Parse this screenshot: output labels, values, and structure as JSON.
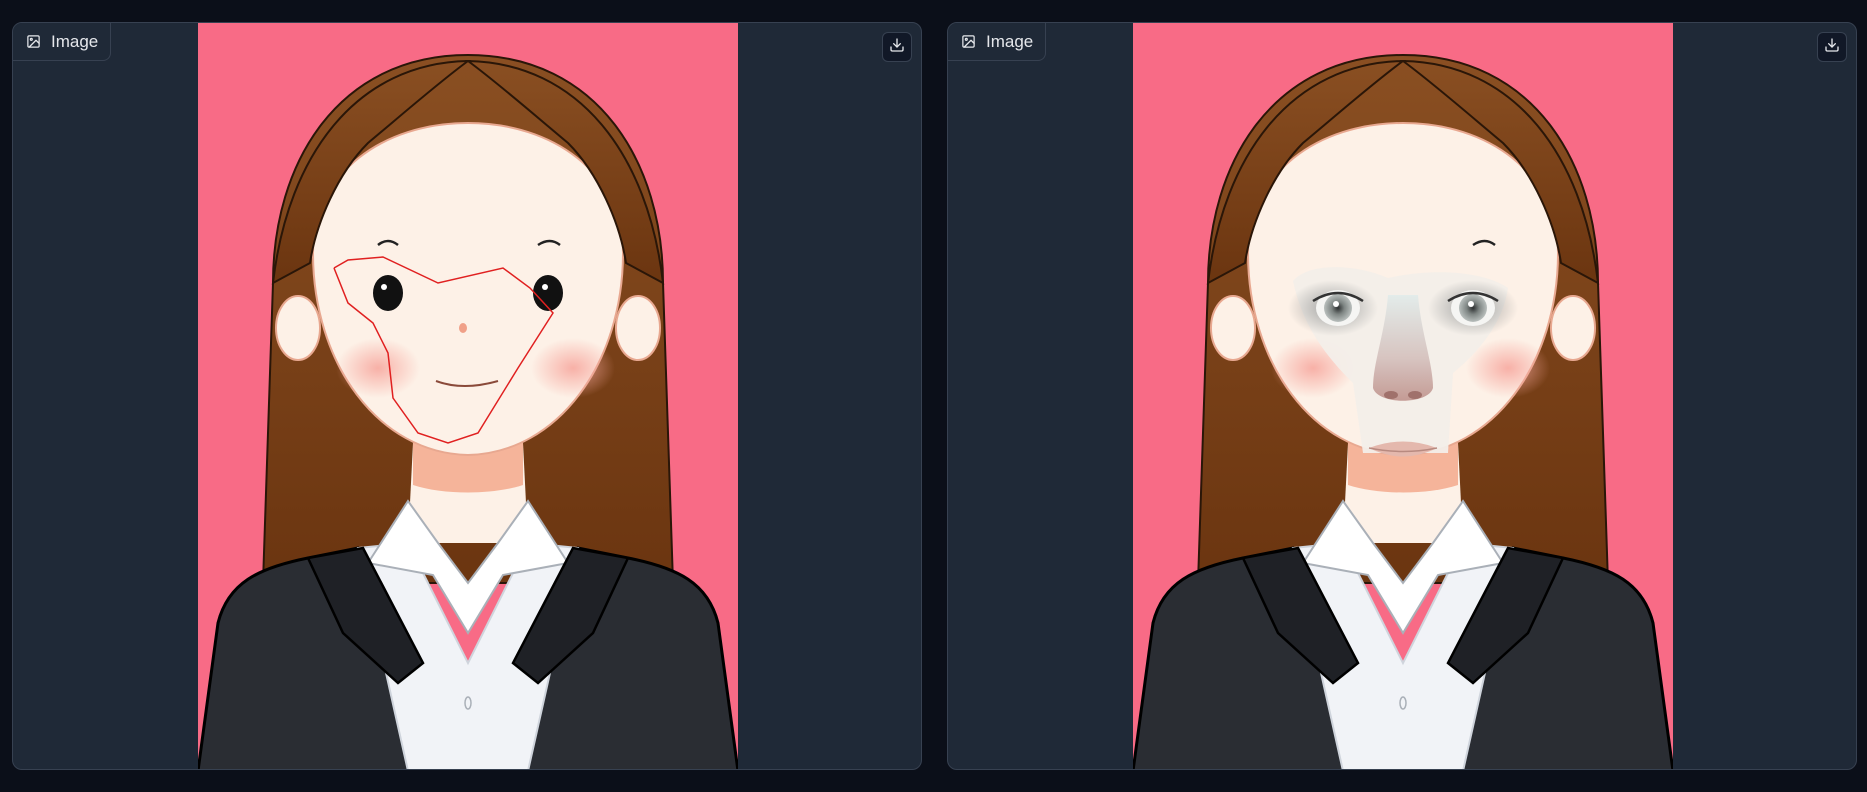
{
  "panels": [
    {
      "label": "Image",
      "image_icon": "image-icon",
      "download_icon": "download-icon",
      "content": "cartoon-portrait-with-red-mask-outline"
    },
    {
      "label": "Image",
      "image_icon": "image-icon",
      "download_icon": "download-icon",
      "content": "cartoon-portrait-with-realistic-face-swap"
    }
  ],
  "colors": {
    "page_bg": "#0b0f19",
    "panel_bg": "#1f2937",
    "panel_border": "#374151",
    "image_bg": "#f86b86",
    "hair": "#7a4318",
    "skin": "#fdf1e7",
    "jacket": "#2a2d33",
    "mask_outline": "#e02020"
  }
}
